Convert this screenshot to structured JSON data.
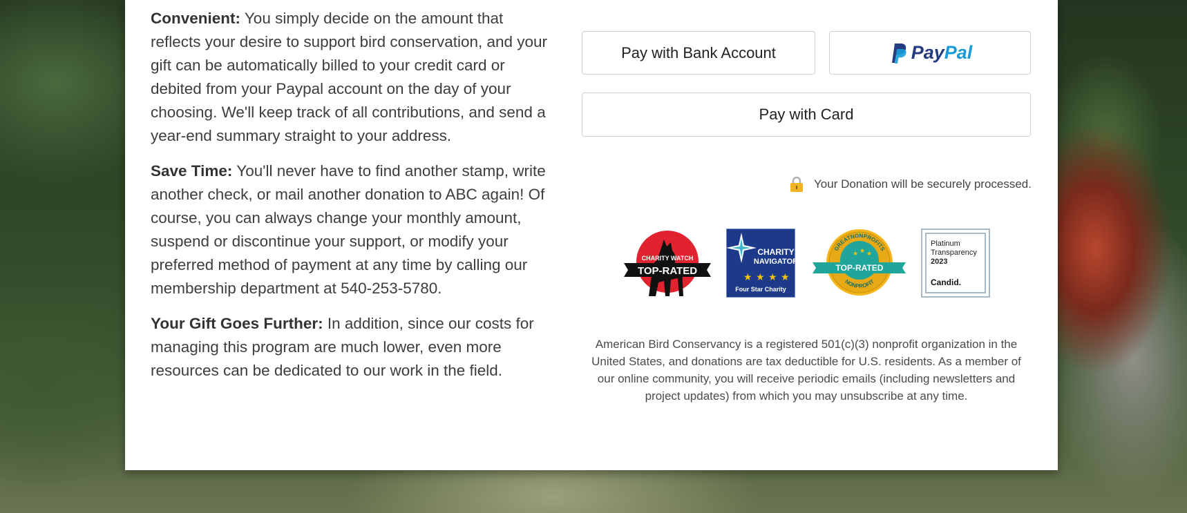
{
  "benefits": [
    {
      "heading": "Convenient:",
      "text": " You simply decide on the amount that reflects your desire to support bird conservation, and your gift can be automatically billed to your credit card or debited from your Paypal account on the day of your choosing. We'll keep track of all contributions, and send a year-end summary straight to your address."
    },
    {
      "heading": "Save Time:",
      "text": " You'll never have to find another stamp, write another check, or mail another donation to ABC again! Of course, you can always change your monthly amount, suspend or discontinue your support, or modify your preferred method of payment at any time by calling our membership department at 540-253-5780."
    },
    {
      "heading": "Your Gift Goes Further:",
      "text": " In addition, since our costs for managing this program are much lower, even more resources can be dedicated to our work in the field."
    }
  ],
  "payment": {
    "bank_label": "Pay with Bank Account",
    "paypal_pay": "Pay",
    "paypal_pal": "Pal",
    "card_label": "Pay with Card"
  },
  "secure_note": "Your Donation will be securely processed.",
  "badges": {
    "charity_watch": {
      "line1": "CHARITY WATCH",
      "line2": "TOP-RATED"
    },
    "charity_navigator": {
      "line1": "CHARITY",
      "line2": "NAVIGATOR",
      "line3": "Four Star Charity"
    },
    "great_nonprofits": {
      "ring_top": "GREATNONPROFITS",
      "ribbon": "TOP-RATED",
      "ring_bottom": "NONPROFIT"
    },
    "candid": {
      "line1": "Platinum",
      "line2": "Transparency",
      "line3": "2023",
      "brand": "Candid."
    }
  },
  "disclaimer": "American Bird Conservancy is a registered 501(c)(3) nonprofit organization in the United States, and donations are tax deductible for U.S. residents. As a member of our online community, you will receive periodic emails (including newsletters and project updates) from which you may unsubscribe at any time.",
  "colors": {
    "paypal_dark": "#253b80",
    "paypal_light": "#179bd7",
    "charity_watch_red": "#e0232e",
    "charity_navigator_blue": "#1d3a8a",
    "great_nonprofits_gold": "#f2b51a",
    "great_nonprofits_teal": "#1fa59a",
    "lock": "#f0b323"
  }
}
